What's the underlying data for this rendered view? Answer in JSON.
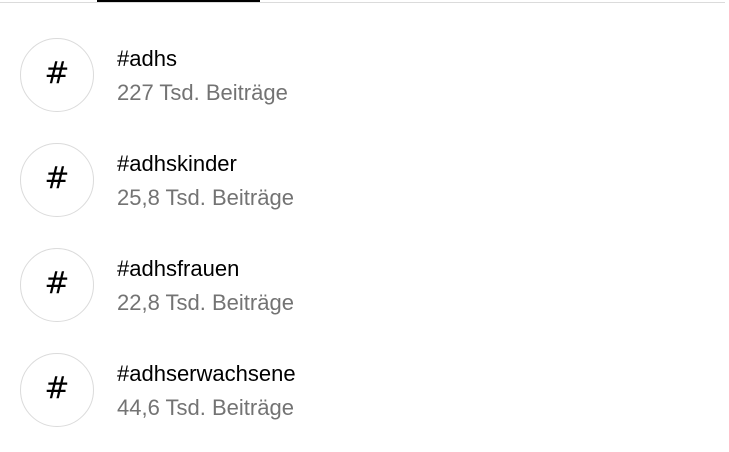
{
  "results": [
    {
      "icon": "hashtag-icon",
      "symbol": "#",
      "tag": "#adhs",
      "count": "227 Tsd. Beiträge"
    },
    {
      "icon": "hashtag-icon",
      "symbol": "#",
      "tag": "#adhskinder",
      "count": "25,8 Tsd. Beiträge"
    },
    {
      "icon": "hashtag-icon",
      "symbol": "#",
      "tag": "#adhsfrauen",
      "count": "22,8 Tsd. Beiträge"
    },
    {
      "icon": "hashtag-icon",
      "symbol": "#",
      "tag": "#adhserwachsene",
      "count": "44,6 Tsd. Beiträge"
    }
  ],
  "colors": {
    "primary_text": "#000000",
    "secondary_text": "#737373",
    "border": "#dbdbdb",
    "active_tab": "#000000"
  }
}
